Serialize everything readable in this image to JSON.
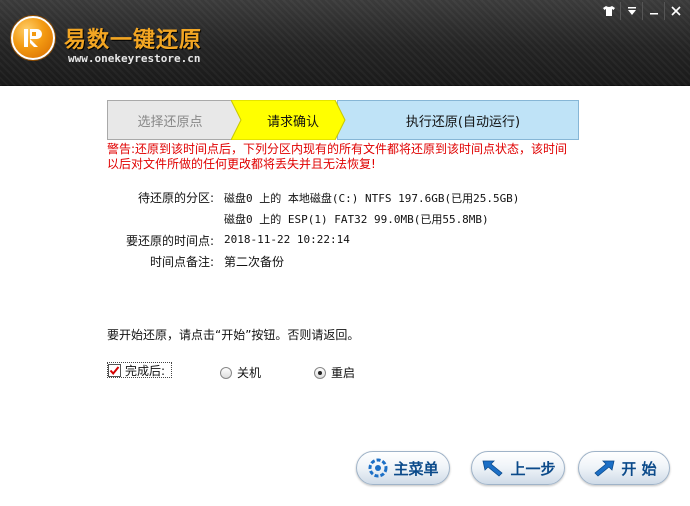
{
  "header": {
    "title": "易数一键还原",
    "url": "www.onekeyrestore.cn"
  },
  "window_controls": [
    "shirt-icon",
    "menu-icon",
    "minimize-icon",
    "close-icon"
  ],
  "steps": {
    "step1": "选择还原点",
    "step2": "请求确认",
    "step3": "执行还原(自动运行)"
  },
  "warning": {
    "prefix": "警告:",
    "line1": "还原到该时间点后，下列分区内现有的所有文件都将还原到该时间点状态，该时间",
    "line2": "以后对文件所做的任何更改都将丢失并且无法恢复!"
  },
  "info": {
    "partition_label": "待还原的分区:",
    "partition_1": "磁盘0 上的 本地磁盘(C:) NTFS 197.6GB(已用25.5GB)",
    "partition_2": "磁盘0 上的 ESP(1) FAT32 99.0MB(已用55.8MB)",
    "time_label": "要还原的时间点:",
    "time_value": "2018-11-22 10:22:14",
    "note_label": "时间点备注:",
    "note_value": "第二次备份"
  },
  "prompt": "要开始还原，请点击“开始”按钮。否则请返回。",
  "after_complete": {
    "label": "完成后:",
    "checked": true,
    "options": [
      "关机",
      "重启"
    ],
    "selected": "重启"
  },
  "buttons": {
    "main_menu": "主菜单",
    "previous": "上一步",
    "start": "开 始"
  },
  "colors": {
    "header_bg": "#242424",
    "title": "#f3a623",
    "step_active": "#ffff00",
    "step_next": "#bfe3f7",
    "warning": "#e00000",
    "button_text": "#0b4a8a"
  }
}
